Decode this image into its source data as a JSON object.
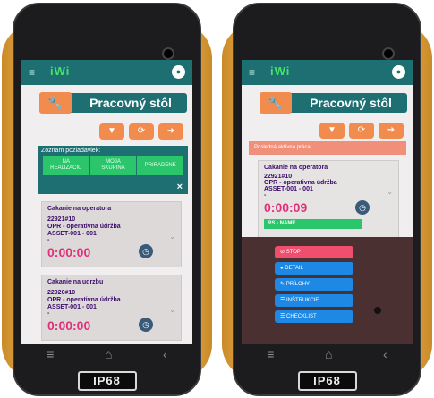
{
  "device_badge": "IP68",
  "navbar": {
    "back_icon": "‹",
    "home_icon": "⌂",
    "menu_icon": "≡"
  },
  "app": {
    "logo": "iWi",
    "menu_icon": "≡",
    "avatar_icon": "●"
  },
  "left_screen": {
    "title": "Pracovný stôl",
    "wrench_icon": "wrench-icon",
    "buttons": {
      "filter": "▼",
      "refresh": "⟳",
      "exit": "➜"
    },
    "request_panel": {
      "label": "Zoznam poziadaviek:",
      "tabs": [
        {
          "line1": "NA",
          "line2": "REALIZACIU"
        },
        {
          "line1": "MOJA",
          "line2": "SKUPINA"
        },
        {
          "line1": "PRIRADENE",
          "line2": ""
        }
      ],
      "close": "×"
    },
    "cards": [
      {
        "title": "Cakanie na operatora",
        "id": "22921#10",
        "type": "OPR - operativna údržba",
        "asset": "ASSET-001 - 001",
        "dash": "-",
        "timer": "0:00:00"
      },
      {
        "title": "Cakanie na udrzbu",
        "id": "22920#10",
        "type": "OPR - operativna údržba",
        "asset": "ASSET-001 - 001",
        "dash": "-",
        "timer": "0:00:00"
      }
    ]
  },
  "right_screen": {
    "title": "Pracovný stôl",
    "buttons": {
      "filter": "▼",
      "refresh": "⟳",
      "exit": "➜"
    },
    "last_active_label": "Posledná aktívna práca:",
    "card": {
      "title": "Cakanie na operatora",
      "id": "22921#10",
      "type": "OPR - operativna údržba",
      "asset": "ASSET-001 - 001",
      "dash": "-",
      "timer": "0:00:09",
      "rs_name": "RS - NAME"
    },
    "actions": [
      {
        "label": "⊘ STOP",
        "color": "#ef4f6f"
      },
      {
        "label": "● DETAIL",
        "color": "#1e88e5"
      },
      {
        "label": "✎ PRÍLOHY",
        "color": "#1e88e5"
      },
      {
        "label": "☰ INŠTRUKCIE",
        "color": "#1e88e5"
      },
      {
        "label": "☰ CHECKLIST",
        "color": "#1e88e5"
      }
    ]
  }
}
